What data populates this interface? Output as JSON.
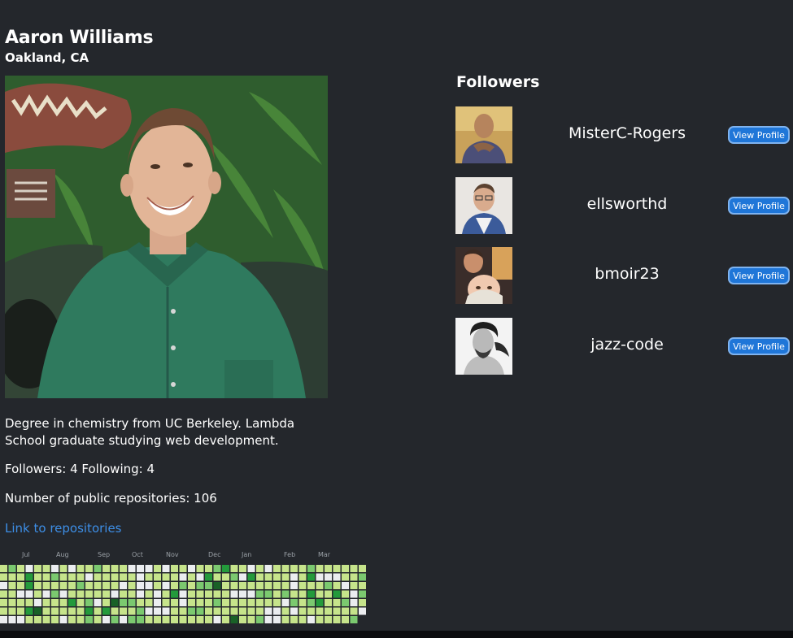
{
  "profile": {
    "name": "Aaron Williams",
    "location": "Oakland, CA",
    "bio": "Degree in chemistry from UC Berkeley. Lambda School graduate studying web development.",
    "stats": "Followers: 4 Following: 4",
    "repos": "Number of public repositories: 106",
    "repo_link": "Link to repositories"
  },
  "contributions": {
    "months": [
      "Jul",
      "Aug",
      "Sep",
      "Oct",
      "Nov",
      "Dec",
      "Jan",
      "Feb",
      "Mar"
    ],
    "weeks": 43,
    "colors": [
      "#ebedf0",
      "#c6e48b",
      "#7bc96f",
      "#239a3b",
      "#196127"
    ]
  },
  "followers": {
    "title": "Followers",
    "button_label": "View Profile",
    "items": [
      {
        "login": "MisterC-Rogers"
      },
      {
        "login": "ellsworthd"
      },
      {
        "login": "bmoir23"
      },
      {
        "login": "jazz-code"
      }
    ]
  },
  "colors": {
    "background": "#24272c",
    "link": "#3d8ee6",
    "button": "#1f76d8"
  }
}
